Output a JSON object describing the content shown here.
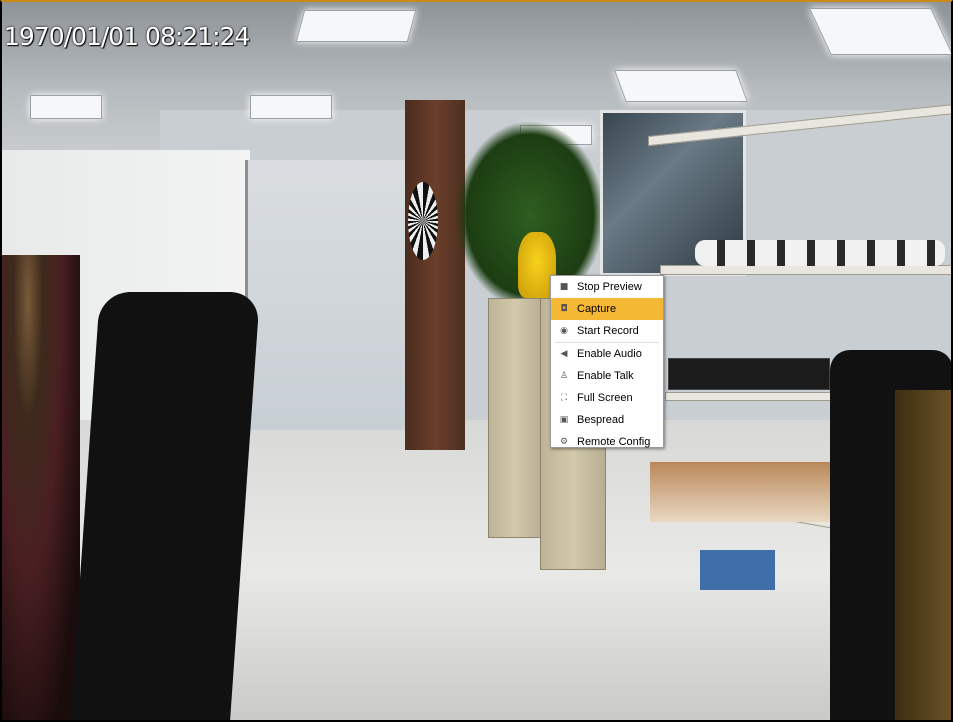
{
  "osd": {
    "timestamp": "1970/01/01 08:21:24"
  },
  "context_menu": {
    "items": [
      {
        "label": "Stop Preview",
        "icon": "stop-icon",
        "glyph": "■",
        "active": false
      },
      {
        "label": "Capture",
        "icon": "camera-icon",
        "glyph": "◘",
        "active": true
      },
      {
        "label": "Start Record",
        "icon": "record-icon",
        "glyph": "◉",
        "active": false
      },
      {
        "label": "Enable Audio",
        "icon": "speaker-icon",
        "glyph": "◀",
        "active": false
      },
      {
        "label": "Enable Talk",
        "icon": "microphone-icon",
        "glyph": "♙",
        "active": false
      },
      {
        "label": "Full Screen",
        "icon": "fullscreen-icon",
        "glyph": "⛶",
        "active": false
      },
      {
        "label": "Bespread",
        "icon": "bespread-icon",
        "glyph": "▣",
        "active": false
      },
      {
        "label": "Remote Config",
        "icon": "gear-icon",
        "glyph": "⚙",
        "active": false
      }
    ]
  },
  "colors": {
    "accent": "#f5b835",
    "frame_top": "#c98a17"
  }
}
